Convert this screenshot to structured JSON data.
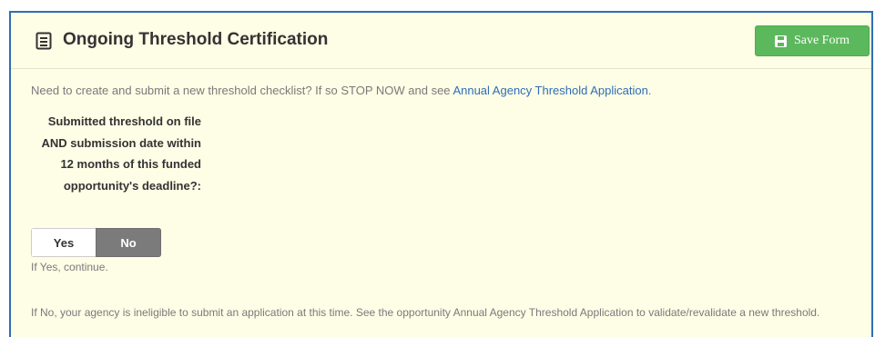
{
  "panel": {
    "title": "Ongoing Threshold Certification",
    "title_icon": "document-list-icon",
    "save_button": {
      "label": "Save Form",
      "icon": "floppy-disk-icon",
      "color": "#5cb85c"
    }
  },
  "intro": {
    "text": "Need to create and submit a new threshold checklist? If so STOP NOW and see ",
    "link_text": "Annual Agency Threshold Application",
    "suffix": "."
  },
  "question": {
    "label": "Submitted threshold on file AND submission date within 12 months of this funded opportunity's deadline?:",
    "options": {
      "yes": "Yes",
      "no": "No"
    },
    "selected": "No"
  },
  "hints": {
    "yes": "If Yes, continue.",
    "no": "If No, your agency is ineligible to submit an application at this time. See the opportunity Annual Agency Threshold Application to validate/revalidate a new threshold."
  },
  "colors": {
    "panel_background": "#fefde6",
    "panel_border": "#2f6eb5",
    "link": "#2f6eb5",
    "selected_toggle": "#7b7b7b"
  }
}
